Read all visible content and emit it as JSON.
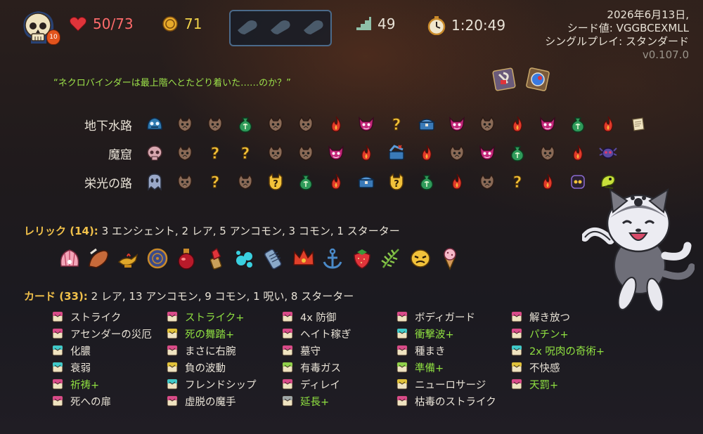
{
  "topbar": {
    "hp": "50/73",
    "gold": "71",
    "floor": "49",
    "time": "1:20:49",
    "ascension": "10"
  },
  "run_info": {
    "date": "2026年6月13日,",
    "seed": "シード値: VGGBCEXMLL",
    "mode": "シングルプレイ: スタンダード",
    "version": "v0.107.0"
  },
  "quote": "“ネクロバインダーは最上階へとたどり着いた……のか？”",
  "acts": [
    {
      "name": "地下水路",
      "nodes": [
        "boss-slime",
        "monster",
        "monster",
        "treasure-bag",
        "monster",
        "monster",
        "rest",
        "elite",
        "unknown",
        "chest",
        "elite",
        "monster",
        "rest",
        "elite",
        "treasure-bag",
        "rest",
        "scroll"
      ]
    },
    {
      "name": "魔窟",
      "nodes": [
        "boss-skull",
        "monster",
        "unknown",
        "unknown",
        "monster",
        "monster",
        "elite",
        "rest",
        "chest-open",
        "rest",
        "monster",
        "elite",
        "treasure-bag",
        "monster",
        "rest",
        "boss-spider"
      ]
    },
    {
      "name": "栄光の路",
      "nodes": [
        "boss-ghost",
        "monster",
        "unknown",
        "monster",
        "unknown-event",
        "treasure-bag",
        "rest",
        "chest",
        "unknown-event",
        "treasure-bag",
        "rest",
        "monster",
        "unknown",
        "rest",
        "boss-dark",
        "boss-worm"
      ]
    }
  ],
  "relics": {
    "label": "レリック (14):",
    "summary": "3 エンシェント, 2 レア, 5 アンコモン, 3 コモン, 1 スターター",
    "items": [
      "shell-relic",
      "horn-relic",
      "lamp-relic",
      "clock-relic",
      "flask-relic",
      "lipstick-relic",
      "splash-relic",
      "bandage-relic",
      "crown-relic",
      "anchor-relic",
      "strawberry-relic",
      "fern-relic",
      "mask-relic",
      "icecream-relic"
    ]
  },
  "cards": {
    "label": "カード (33):",
    "summary": "2 レア, 13 アンコモン, 9 コモン, 1 呪い, 8 スターター",
    "columns": [
      [
        {
          "name": "ストライク",
          "upgraded": false,
          "color": "#d94b8a"
        },
        {
          "name": "アセンダーの災厄",
          "upgraded": false,
          "color": "#d94b8a"
        },
        {
          "name": "化膿",
          "upgraded": false,
          "color": "#3fc9c9"
        },
        {
          "name": "衰弱",
          "upgraded": false,
          "color": "#3fc9c9"
        },
        {
          "name": "祈祷+",
          "upgraded": true,
          "color": "#d94b8a"
        },
        {
          "name": "死への扉",
          "upgraded": false,
          "color": "#d94b8a"
        }
      ],
      [
        {
          "name": "ストライク+",
          "upgraded": true,
          "color": "#d94b8a"
        },
        {
          "name": "死の舞踏+",
          "upgraded": true,
          "color": "#e0c23a"
        },
        {
          "name": "まさに右腕",
          "upgraded": false,
          "color": "#d94b8a"
        },
        {
          "name": "負の波動",
          "upgraded": false,
          "color": "#e0c23a"
        },
        {
          "name": "フレンドシップ",
          "upgraded": false,
          "color": "#3fc9c9"
        },
        {
          "name": "虚脱の魔手",
          "upgraded": false,
          "color": "#d94b8a"
        }
      ],
      [
        {
          "name": "4x 防御",
          "upgraded": false,
          "color": "#d94b8a"
        },
        {
          "name": "ヘイト稼ぎ",
          "upgraded": false,
          "color": "#d94b8a"
        },
        {
          "name": "墓守",
          "upgraded": false,
          "color": "#d94b8a"
        },
        {
          "name": "有毒ガス",
          "upgraded": false,
          "color": "#8fd04a"
        },
        {
          "name": "ディレイ",
          "upgraded": false,
          "color": "#d94b8a"
        },
        {
          "name": "延長+",
          "upgraded": true,
          "color": "#a0a8a8"
        }
      ],
      [
        {
          "name": "ボディガード",
          "upgraded": false,
          "color": "#d94b8a"
        },
        {
          "name": "衝撃波+",
          "upgraded": true,
          "color": "#3fc9c9"
        },
        {
          "name": "種まき",
          "upgraded": false,
          "color": "#d94b8a"
        },
        {
          "name": "準備+",
          "upgraded": true,
          "color": "#8fd04a"
        },
        {
          "name": "ニューロサージ",
          "upgraded": false,
          "color": "#e0c23a"
        },
        {
          "name": "枯毒のストライク",
          "upgraded": false,
          "color": "#d94b8a"
        }
      ],
      [
        {
          "name": "解き放つ",
          "upgraded": false,
          "color": "#d94b8a"
        },
        {
          "name": "パチン+",
          "upgraded": true,
          "color": "#d94b8a"
        },
        {
          "name": "2x 呪肉の奇術+",
          "upgraded": true,
          "color": "#3fc9c9"
        },
        {
          "name": "不快感",
          "upgraded": false,
          "color": "#e0c23a"
        },
        {
          "name": "天罰+",
          "upgraded": true,
          "color": "#d94b8a"
        }
      ]
    ]
  },
  "colors": {
    "hp": "#ff6b6b",
    "gold": "#f0d24a",
    "upgraded": "#8fe041",
    "section_label": "#f0c04a",
    "quote": "#9de34a"
  }
}
